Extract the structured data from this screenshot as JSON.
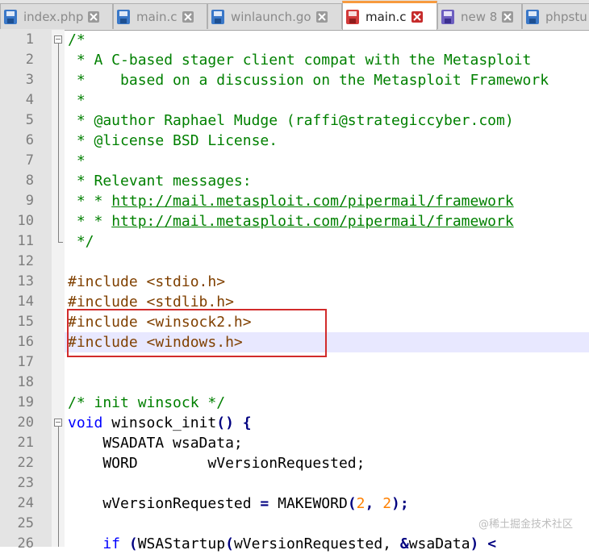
{
  "tabs": [
    {
      "label": "index.php",
      "active": false,
      "modified": false
    },
    {
      "label": "main.c",
      "active": false,
      "modified": false
    },
    {
      "label": "winlaunch.go",
      "active": false,
      "modified": false
    },
    {
      "label": "main.c",
      "active": true,
      "modified": true
    },
    {
      "label": "new 8",
      "active": false,
      "modified": false
    },
    {
      "label": "phpstu",
      "active": false,
      "modified": false
    }
  ],
  "line_numbers": [
    "1",
    "2",
    "3",
    "4",
    "5",
    "6",
    "7",
    "8",
    "9",
    "10",
    "11",
    "12",
    "13",
    "14",
    "15",
    "16",
    "17",
    "18",
    "19",
    "20",
    "21",
    "22",
    "23",
    "24",
    "25",
    "26"
  ],
  "code": {
    "l1": "/*",
    "l2": " * A C-based stager client compat with the Metasploit",
    "l3": " *    based on a discussion on the Metasploit Framework",
    "l4": " *",
    "l5": " * @author Raphael Mudge (raffi@strategiccyber.com)",
    "l6": " * @license BSD License.",
    "l7": " *",
    "l8": " * Relevant messages:",
    "l9_prefix": " * * ",
    "l9_url": "http://mail.metasploit.com/pipermail/framework",
    "l10_prefix": " * * ",
    "l10_url": "http://mail.metasploit.com/pipermail/framework",
    "l11": " */",
    "l13_dir": "#include",
    "l13_file": " <stdio.h>",
    "l14_dir": "#include",
    "l14_file": " <stdlib.h>",
    "l15_dir": "#include",
    "l15_file": " <winsock2.h>",
    "l16_dir": "#include",
    "l16_file": " <windows.h>",
    "l19": "/* init winsock */",
    "l20_kw": "void",
    "l20_name": " winsock_init",
    "l20_paren": "()",
    "l20_brace": " {",
    "l21": "    WSADATA wsaData;",
    "l22": "    WORD        wVersionRequested;",
    "l24_a": "    wVersionRequested ",
    "l24_eq": "=",
    "l24_b": " MAKEWORD",
    "l24_p1": "(",
    "l24_n1": "2",
    "l24_c": ", ",
    "l24_n2": "2",
    "l24_p2": ");",
    "l26_kw": "    if",
    "l26_p": " (",
    "l26_b": "WSAStartup",
    "l26_p2": "(",
    "l26_c": "wVersionRequested, ",
    "l26_amp": "&",
    "l26_d": "wsaData",
    "l26_e": ") <"
  },
  "watermark": "@稀土掘金技术社区",
  "colors": {
    "comment": "#008000",
    "preprocessor": "#804000",
    "keyword": "#0000ff",
    "number": "#ff8000",
    "highlight_box": "#d22b2b",
    "active_tab_accent": "#f79a3e"
  }
}
